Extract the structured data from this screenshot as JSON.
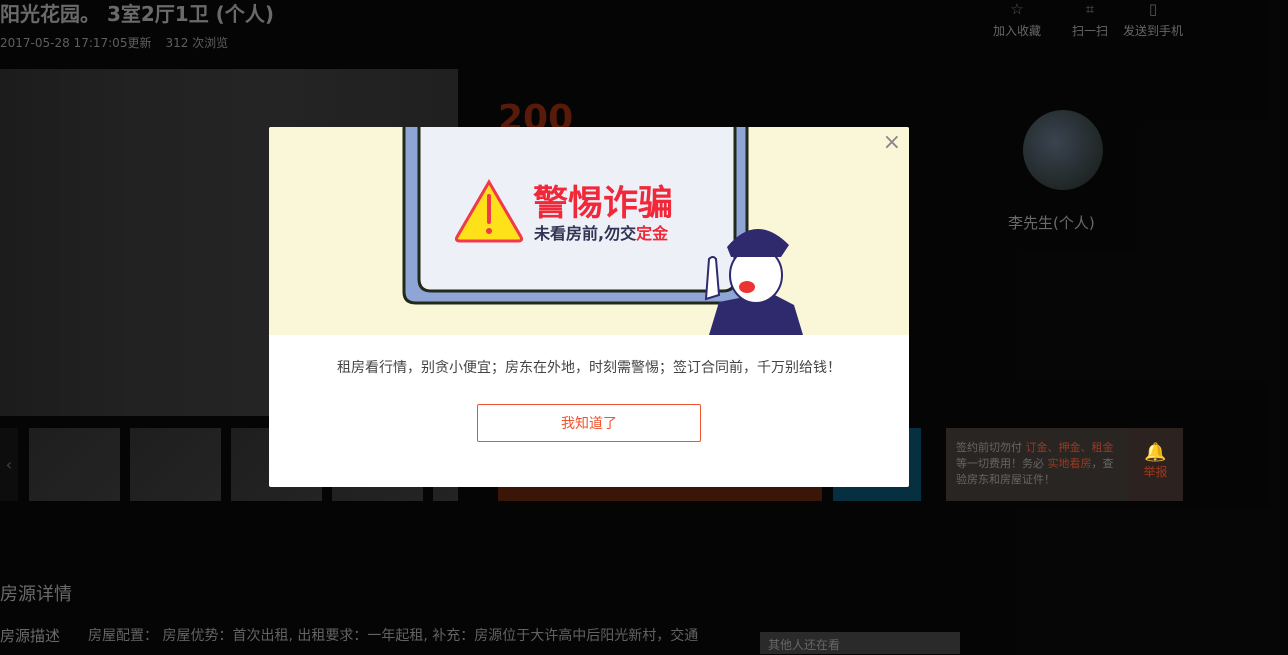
{
  "listing": {
    "title": "阳光花园。 3室2厅1卫 (个人)",
    "updated": "2017-05-28 17:17:05更新",
    "views": "312 次浏览",
    "price": "200"
  },
  "top_actions": [
    {
      "icon": "star-icon",
      "label": "加入收藏"
    },
    {
      "icon": "scan-icon",
      "label": "扫一扫"
    },
    {
      "icon": "phone-icon",
      "label": "发送到手机"
    }
  ],
  "landlord": {
    "name": "李先生(个人)"
  },
  "tip": {
    "p1": "签约前切勿付 ",
    "r1": "订金、押金、租金",
    "p2": "等一切费用！务必 ",
    "r2": "实地看房",
    "p3": "，查验房东和房屋证件！"
  },
  "report": {
    "label": "举报",
    "icon": "alarm-icon"
  },
  "gallery": {
    "prev": "‹"
  },
  "section": {
    "title": "房源详情",
    "desc_label": "房源描述",
    "desc": "房屋配置： 房屋优势：首次出租, 出租要求：一年起租, 补充：房源位于大许高中后阳光新村，交通",
    "other": "其他人还在看"
  },
  "modal": {
    "banner_title": "警惕诈骗",
    "banner_sub_a": "未看房前,勿交",
    "banner_sub_b": "定金",
    "close": "×",
    "message": "租房看行情，别贪小便宜；房东在外地，时刻需警惕；签订合同前，千万别给钱！",
    "ok": "我知道了",
    "accent": "#f0532d"
  }
}
